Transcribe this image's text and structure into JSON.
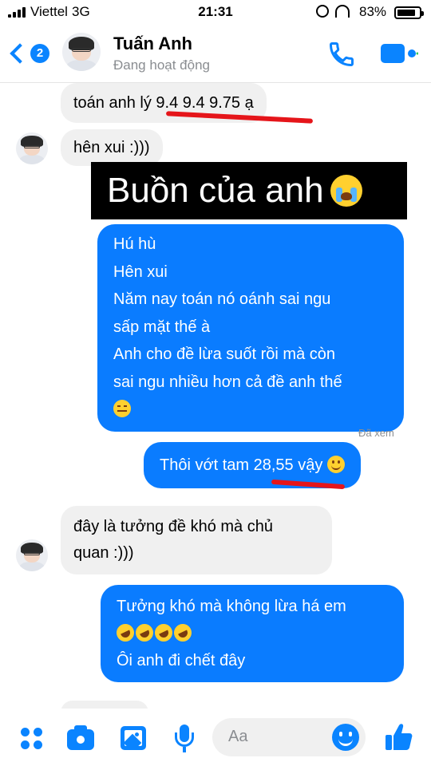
{
  "status_bar": {
    "carrier": "Viettel",
    "network": "3G",
    "time": "21:31",
    "battery_percent": "83%",
    "battery_level": 0.83
  },
  "header": {
    "unread_count": "2",
    "contact_name": "Tuấn Anh",
    "contact_status": "Đang hoạt động",
    "icons": [
      "back-chevron-icon",
      "phone-icon",
      "video-camera-icon"
    ]
  },
  "messages": [
    {
      "side": "in",
      "text": "toán anh lý 9.4 9.4 9.75 ạ"
    },
    {
      "side": "in",
      "text": "hên xui :)))"
    },
    {
      "side": "overlay",
      "text": "Buồn của anh",
      "emoji": "crying-face"
    },
    {
      "side": "out",
      "lines": [
        "Hú hù",
        "Hên xui",
        "Năm nay toán nó oánh sai ngu",
        "sấp mặt thế à",
        "Anh cho đề lừa suốt rồi mà còn",
        "sai ngu nhiều hơn cả đề anh thế"
      ],
      "emoji": "expressionless-face"
    },
    {
      "side": "out",
      "text": "Thôi vớt tam 28,55 vậy",
      "emoji": "smiling-face"
    },
    {
      "side": "in",
      "lines": [
        "đây là tưởng đề khó mà chủ",
        "quan :)))"
      ]
    },
    {
      "side": "out",
      "lines": [
        "Tưởng khó mà không lừa há em",
        "Ôi anh đi chết đây"
      ],
      "emoji": "rolling-on-floor-laughing",
      "emoji_count": 4
    }
  ],
  "seen_label": "Đã xem",
  "composer": {
    "placeholder": "Aa",
    "icons": [
      "more-apps-icon",
      "camera-icon",
      "image-icon",
      "microphone-icon",
      "emoji-icon",
      "thumbs-up-icon"
    ]
  },
  "colors": {
    "accent": "#0a84ff",
    "outgoing_bubble": "#0a7cff",
    "incoming_bubble": "#f0f0f0",
    "underline_mark": "#e5151a"
  }
}
